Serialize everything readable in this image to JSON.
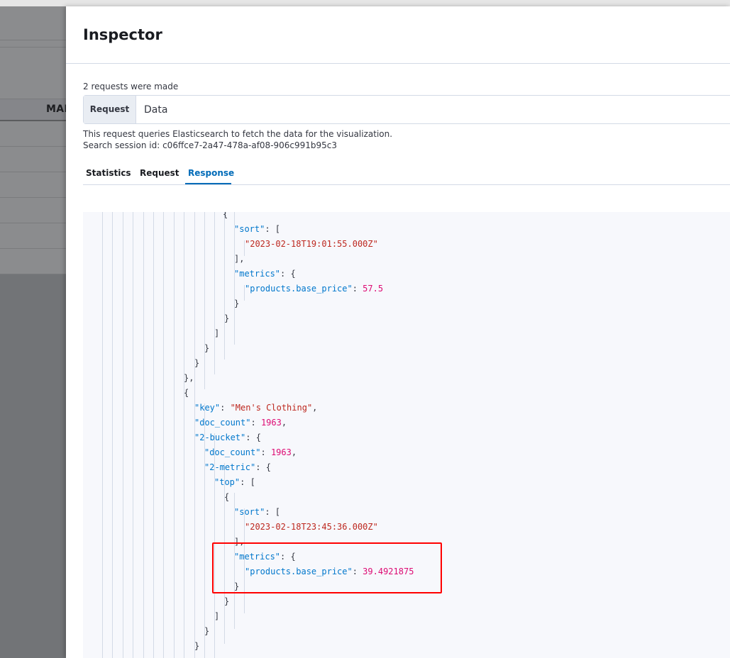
{
  "background": {
    "column_header": "MAL"
  },
  "inspector": {
    "title": "Inspector",
    "requests_made": "2 requests were made",
    "request_label": "Request",
    "request_value": "Data",
    "description": "This request queries Elasticsearch to fetch the data for the visualization.",
    "session": "Search session id: c06ffce7-2a47-478a-af08-906c991b95c3",
    "tabs": {
      "statistics": "Statistics",
      "request": "Request",
      "response": "Response"
    }
  },
  "code": {
    "l1": "{",
    "sort_key": "\"sort\"",
    "sort_open": ": [",
    "sort1_val": "\"2023-02-18T19:01:55.000Z\"",
    "bracket_close_comma": "],",
    "metrics_key": "\"metrics\"",
    "metrics_open": ": {",
    "price_key": "\"products.base_price\"",
    "colon": ": ",
    "price1_val": "57.5",
    "brace_close": "}",
    "bracket_close": "]",
    "brace_close_comma": "},",
    "key_key": "\"key\"",
    "key_val": "\"Men's Clothing\"",
    "comma": ",",
    "doc_count_key": "\"doc_count\"",
    "doc_count_val": "1963",
    "bucket_key": "\"2-bucket\"",
    "metric_key": "\"2-metric\"",
    "top_key": "\"top\"",
    "sort2_val": "\"2023-02-18T23:45:36.000Z\"",
    "price2_val": "39.4921875"
  }
}
